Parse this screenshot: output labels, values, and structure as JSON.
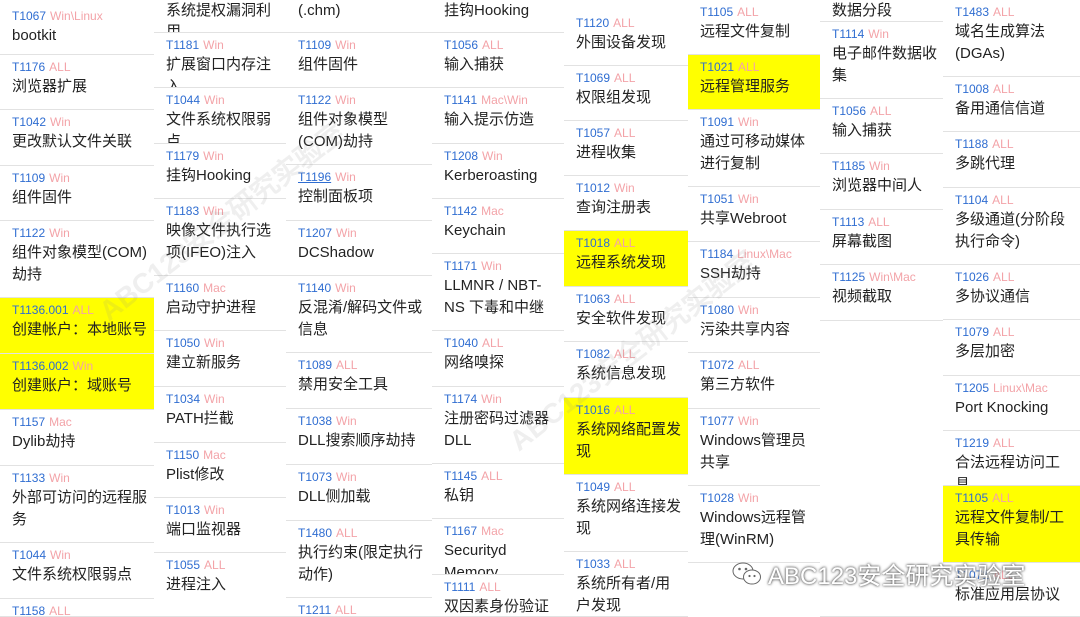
{
  "page": {
    "watermark_text": "ABC123安全研究实验室",
    "brand_badge": "ABC123安全研究实验室",
    "brand_icon": "wechat-icon",
    "colors": {
      "id": "#2f6dd1",
      "platform": "#f3a3a8",
      "name": "#222222",
      "highlight": "#ffff00"
    }
  },
  "columns": [
    {
      "key": "c1",
      "cells": [
        {
          "id": "T1067",
          "platform": "Win\\Linux",
          "name": "bootkit"
        },
        {
          "id": "T1176",
          "platform": "ALL",
          "name": "浏览器扩展"
        },
        {
          "id": "T1042",
          "platform": "Win",
          "name": "更改默认文件关联"
        },
        {
          "id": "T1109",
          "platform": "Win",
          "name": "组件固件"
        },
        {
          "id": "T1122",
          "platform": "Win",
          "name": "组件对象模型(COM)劫持"
        },
        {
          "id": "T1136.001",
          "platform": "ALL",
          "name": "创建帐户：本地账号",
          "highlight": true
        },
        {
          "id": "T1136.002",
          "platform": "Win",
          "name": "创建账户：域账号",
          "highlight": true
        },
        {
          "id": "T1157",
          "platform": "Mac",
          "name": "Dylib劫持"
        },
        {
          "id": "T1133",
          "platform": "Win",
          "name": "外部可访问的远程服务"
        },
        {
          "id": "T1044",
          "platform": "Win",
          "name": "文件系统权限弱点"
        },
        {
          "id": "T1158",
          "platform": "ALL",
          "name": ""
        }
      ]
    },
    {
      "key": "c2",
      "cells": [
        {
          "id": "",
          "platform": "",
          "name": "系统提权漏洞利用"
        },
        {
          "id": "T1181",
          "platform": "Win",
          "name": "扩展窗口内存注入"
        },
        {
          "id": "T1044",
          "platform": "Win",
          "name": "文件系统权限弱点"
        },
        {
          "id": "T1179",
          "platform": "Win",
          "name": "挂钩Hooking"
        },
        {
          "id": "T1183",
          "platform": "Win",
          "name": "映像文件执行选项(IFEO)注入"
        },
        {
          "id": "T1160",
          "platform": "Mac",
          "name": "启动守护进程"
        },
        {
          "id": "T1050",
          "platform": "Win",
          "name": "建立新服务"
        },
        {
          "id": "T1034",
          "platform": "Win",
          "name": "PATH拦截"
        },
        {
          "id": "T1150",
          "platform": "Mac",
          "name": "Plist修改"
        },
        {
          "id": "T1013",
          "platform": "Win",
          "name": "端口监视器"
        },
        {
          "id": "T1055",
          "platform": "ALL",
          "name": "进程注入"
        }
      ]
    },
    {
      "key": "c3",
      "cells": [
        {
          "id": "",
          "platform": "",
          "name": "(.chm)"
        },
        {
          "id": "T1109",
          "platform": "Win",
          "name": "组件固件"
        },
        {
          "id": "T1122",
          "platform": "Win",
          "name": "组件对象模型(COM)劫持"
        },
        {
          "id": "T1196",
          "platform": "Win",
          "name": "控制面板项",
          "underline": true
        },
        {
          "id": "T1207",
          "platform": "Win",
          "name": "DCShadow"
        },
        {
          "id": "T1140",
          "platform": "Win",
          "name": "反混淆/解码文件或信息"
        },
        {
          "id": "T1089",
          "platform": "ALL",
          "name": "禁用安全工具"
        },
        {
          "id": "T1038",
          "platform": "Win",
          "name": "DLL搜索顺序劫持"
        },
        {
          "id": "T1073",
          "platform": "Win",
          "name": "DLL侧加载"
        },
        {
          "id": "T1480",
          "platform": "ALL",
          "name": "执行约束(限定执行动作)"
        },
        {
          "id": "T1211",
          "platform": "ALL",
          "name": ""
        }
      ]
    },
    {
      "key": "c4",
      "cells": [
        {
          "id": "",
          "platform": "",
          "name": "挂钩Hooking"
        },
        {
          "id": "T1056",
          "platform": "ALL",
          "name": "输入捕获"
        },
        {
          "id": "T1141",
          "platform": "Mac\\Win",
          "name": "输入提示仿造"
        },
        {
          "id": "T1208",
          "platform": "Win",
          "name": "Kerberoasting"
        },
        {
          "id": "T1142",
          "platform": "Mac",
          "name": "Keychain"
        },
        {
          "id": "T1171",
          "platform": "Win",
          "name": "LLMNR / NBT-NS 下毒和中继"
        },
        {
          "id": "T1040",
          "platform": "ALL",
          "name": "网络嗅探"
        },
        {
          "id": "T1174",
          "platform": "Win",
          "name": "注册密码过滤器DLL"
        },
        {
          "id": "T1145",
          "platform": "ALL",
          "name": "私钥"
        },
        {
          "id": "T1167",
          "platform": "Mac",
          "name": "Securityd Memory"
        },
        {
          "id": "T1111",
          "platform": "ALL",
          "name": "双因素身份验证拦截"
        }
      ]
    },
    {
      "key": "c5",
      "cells": [
        {
          "id": "T1120",
          "platform": "ALL",
          "name": "外围设备发现"
        },
        {
          "id": "T1069",
          "platform": "ALL",
          "name": "权限组发现"
        },
        {
          "id": "T1057",
          "platform": "ALL",
          "name": "进程收集"
        },
        {
          "id": "T1012",
          "platform": "Win",
          "name": "查询注册表"
        },
        {
          "id": "T1018",
          "platform": "ALL",
          "name": "远程系统发现",
          "highlight": true
        },
        {
          "id": "T1063",
          "platform": "ALL",
          "name": "安全软件发现"
        },
        {
          "id": "T1082",
          "platform": "ALL",
          "name": "系统信息发现"
        },
        {
          "id": "T1016",
          "platform": "ALL",
          "name": "系统网络配置发现",
          "highlight": true
        },
        {
          "id": "T1049",
          "platform": "ALL",
          "name": "系统网络连接发现"
        },
        {
          "id": "T1033",
          "platform": "ALL",
          "name": "系统所有者/用户发现"
        }
      ]
    },
    {
      "key": "c6",
      "cells": [
        {
          "id": "T1105",
          "platform": "ALL",
          "name": "远程文件复制"
        },
        {
          "id": "T1021",
          "platform": "ALL",
          "name": "远程管理服务",
          "highlight": true
        },
        {
          "id": "T1091",
          "platform": "Win",
          "name": "通过可移动媒体进行复制"
        },
        {
          "id": "T1051",
          "platform": "Win",
          "name": "共享Webroot"
        },
        {
          "id": "T1184",
          "platform": "Linux\\Mac",
          "name": "SSH劫持"
        },
        {
          "id": "T1080",
          "platform": "Win",
          "name": "污染共享内容"
        },
        {
          "id": "T1072",
          "platform": "ALL",
          "name": "第三方软件"
        },
        {
          "id": "T1077",
          "platform": "Win",
          "name": "Windows管理员共享"
        },
        {
          "id": "T1028",
          "platform": "Win",
          "name": "Windows远程管理(WinRM)"
        }
      ]
    },
    {
      "key": "c7",
      "cells": [
        {
          "id": "",
          "platform": "",
          "name": "数据分段"
        },
        {
          "id": "T1114",
          "platform": "Win",
          "name": "电子邮件数据收集"
        },
        {
          "id": "T1056",
          "platform": "ALL",
          "name": "输入捕获"
        },
        {
          "id": "T1185",
          "platform": "Win",
          "name": "浏览器中间人"
        },
        {
          "id": "T1113",
          "platform": "ALL",
          "name": "屏幕截图"
        },
        {
          "id": "T1125",
          "platform": "Win\\Mac",
          "name": "视频截取"
        },
        {
          "id": "",
          "platform": "",
          "name": ""
        }
      ]
    },
    {
      "key": "c8",
      "cells": [
        {
          "id": "T1483",
          "platform": "ALL",
          "name": "域名生成算法(DGAs)"
        },
        {
          "id": "T1008",
          "platform": "ALL",
          "name": "备用通信信道"
        },
        {
          "id": "T1188",
          "platform": "ALL",
          "name": "多跳代理"
        },
        {
          "id": "T1104",
          "platform": "ALL",
          "name": "多级通道(分阶段执行命令)"
        },
        {
          "id": "T1026",
          "platform": "ALL",
          "name": "多协议通信"
        },
        {
          "id": "T1079",
          "platform": "ALL",
          "name": "多层加密"
        },
        {
          "id": "T1205",
          "platform": "Linux\\Mac",
          "name": "Port Knocking"
        },
        {
          "id": "T1219",
          "platform": "ALL",
          "name": "合法远程访问工具"
        },
        {
          "id": "T1105",
          "platform": "ALL",
          "name": "远程文件复制/工具传输",
          "highlight": true
        },
        {
          "id": "T1071",
          "platform": "ALL",
          "name": "标准应用层协议"
        }
      ]
    }
  ]
}
